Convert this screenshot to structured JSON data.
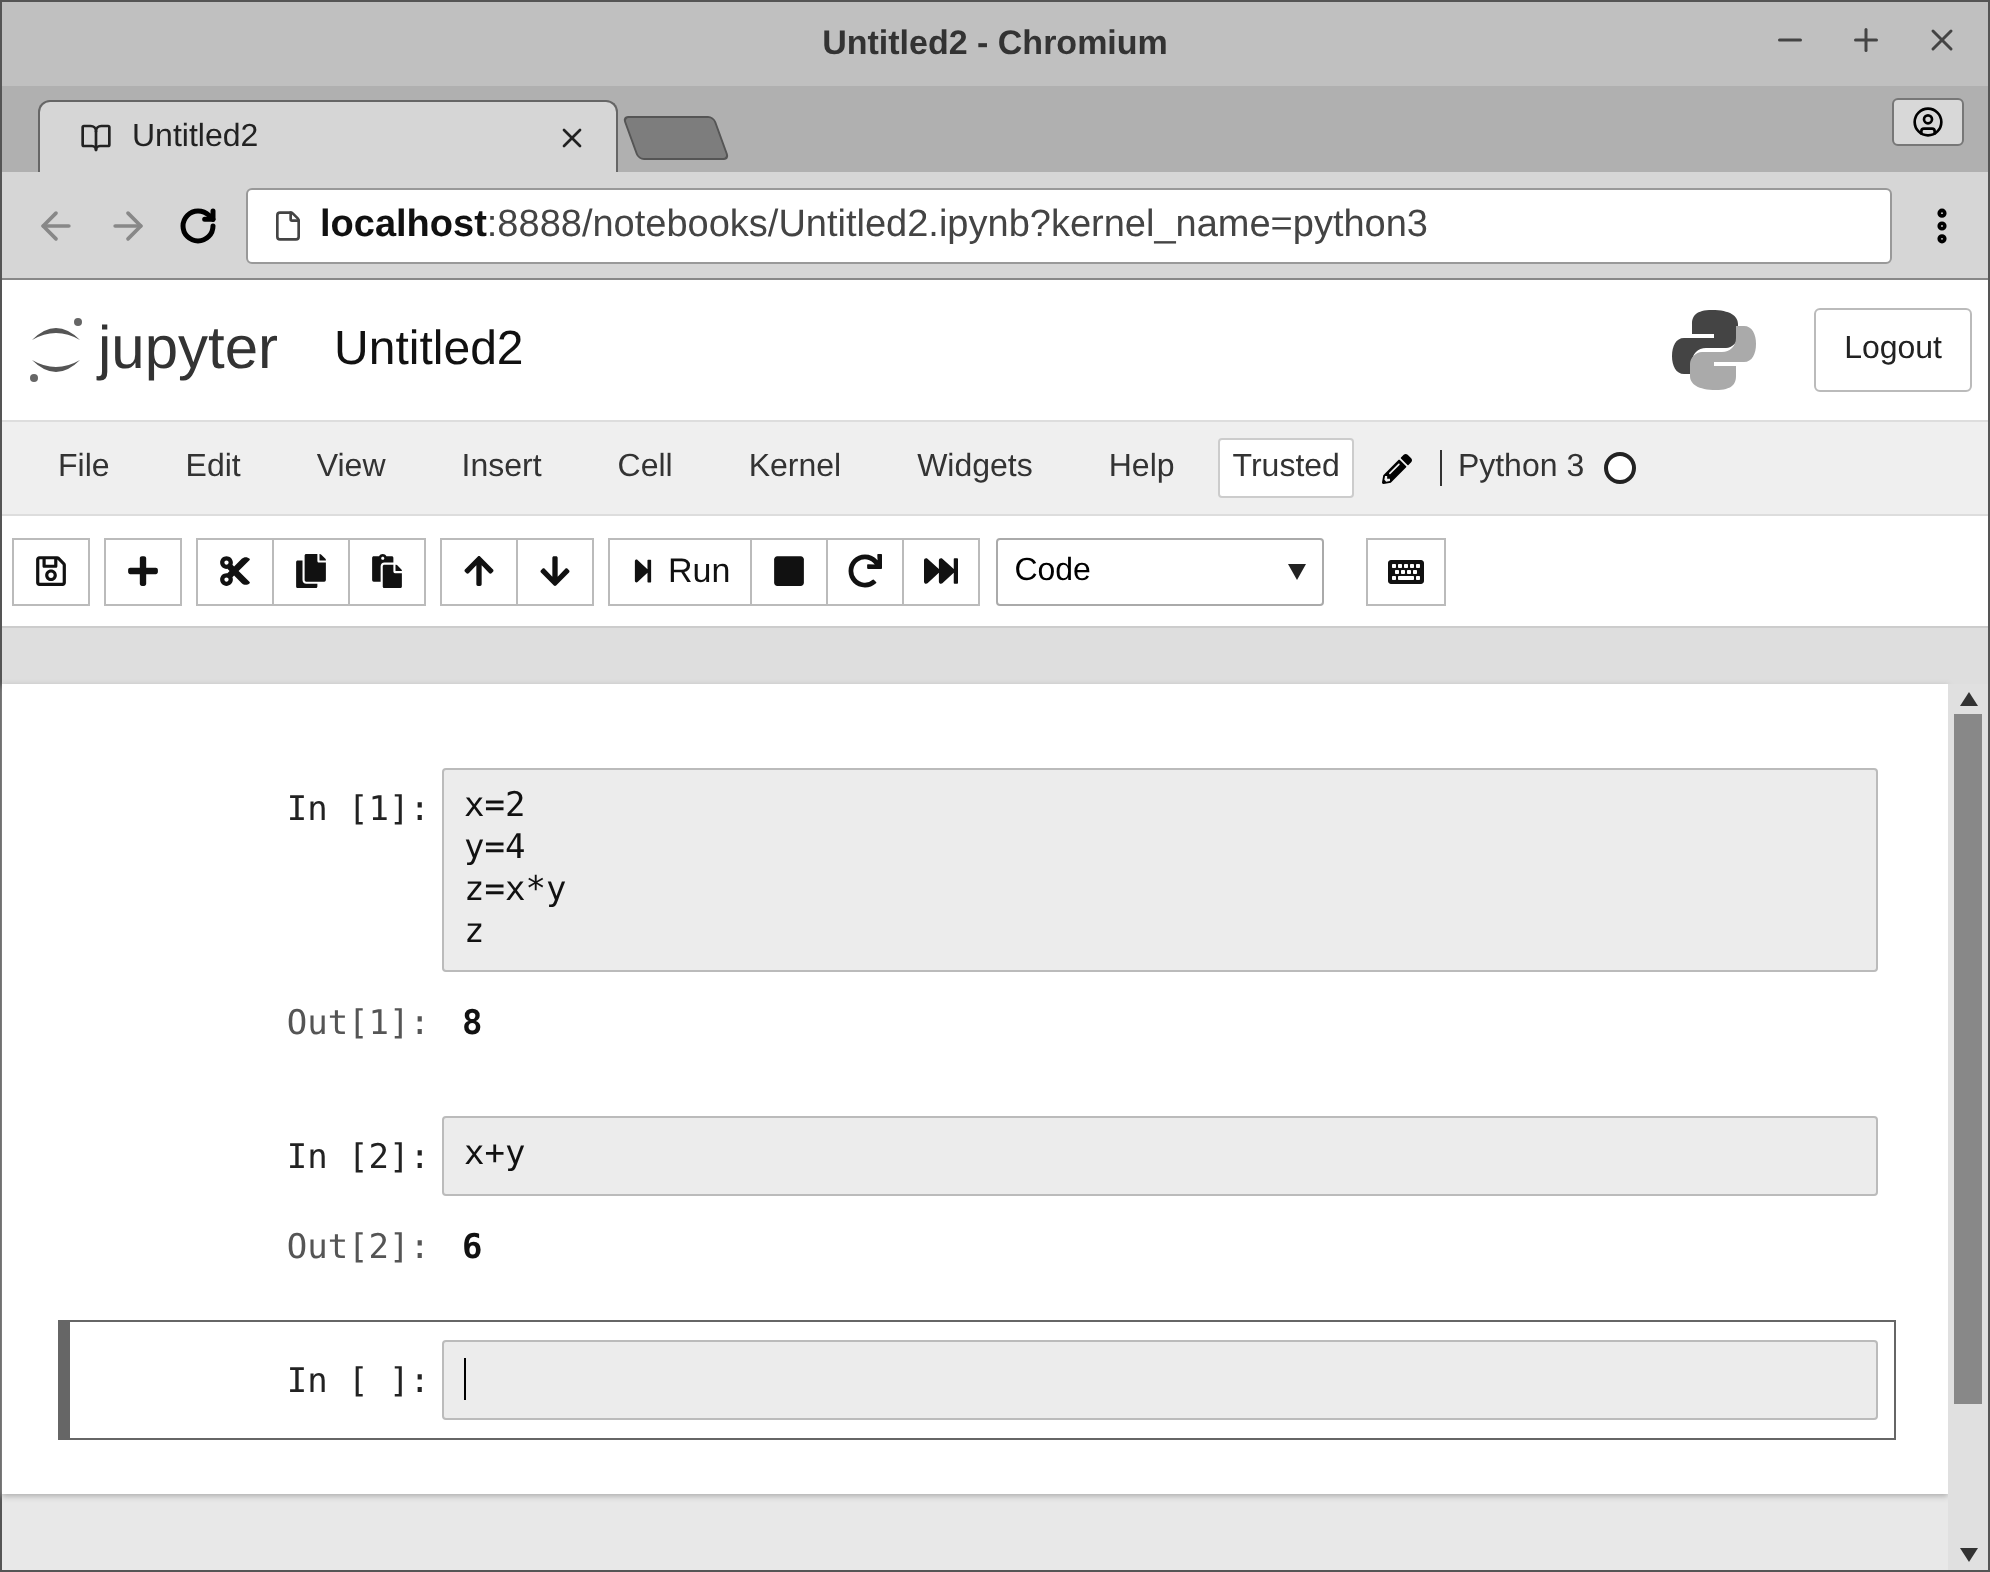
{
  "window": {
    "title": "Untitled2 - Chromium"
  },
  "tabs": [
    {
      "label": "Untitled2",
      "selected": true
    }
  ],
  "address_bar": {
    "host": "localhost",
    "path": ":8888/notebooks/Untitled2.ipynb?kernel_name=python3"
  },
  "header": {
    "logo_text": "jupyter",
    "notebook_name": "Untitled2",
    "logout": "Logout"
  },
  "menu": [
    "File",
    "Edit",
    "View",
    "Insert",
    "Cell",
    "Kernel",
    "Widgets",
    "Help"
  ],
  "trusted": "Trusted",
  "kernel": {
    "name": "Python 3",
    "busy": false
  },
  "toolbar": {
    "run_label": "Run",
    "cell_type": "Code"
  },
  "cells": [
    {
      "prompt": "In [1]:",
      "source": "x=2\ny=4\nz=x*y\nz",
      "output_prompt": "Out[1]:",
      "output": "8",
      "selected": false
    },
    {
      "prompt": "In [2]:",
      "source": "x+y",
      "output_prompt": "Out[2]:",
      "output": "6",
      "selected": false
    },
    {
      "prompt": "In [ ]:",
      "selected": true
    }
  ]
}
